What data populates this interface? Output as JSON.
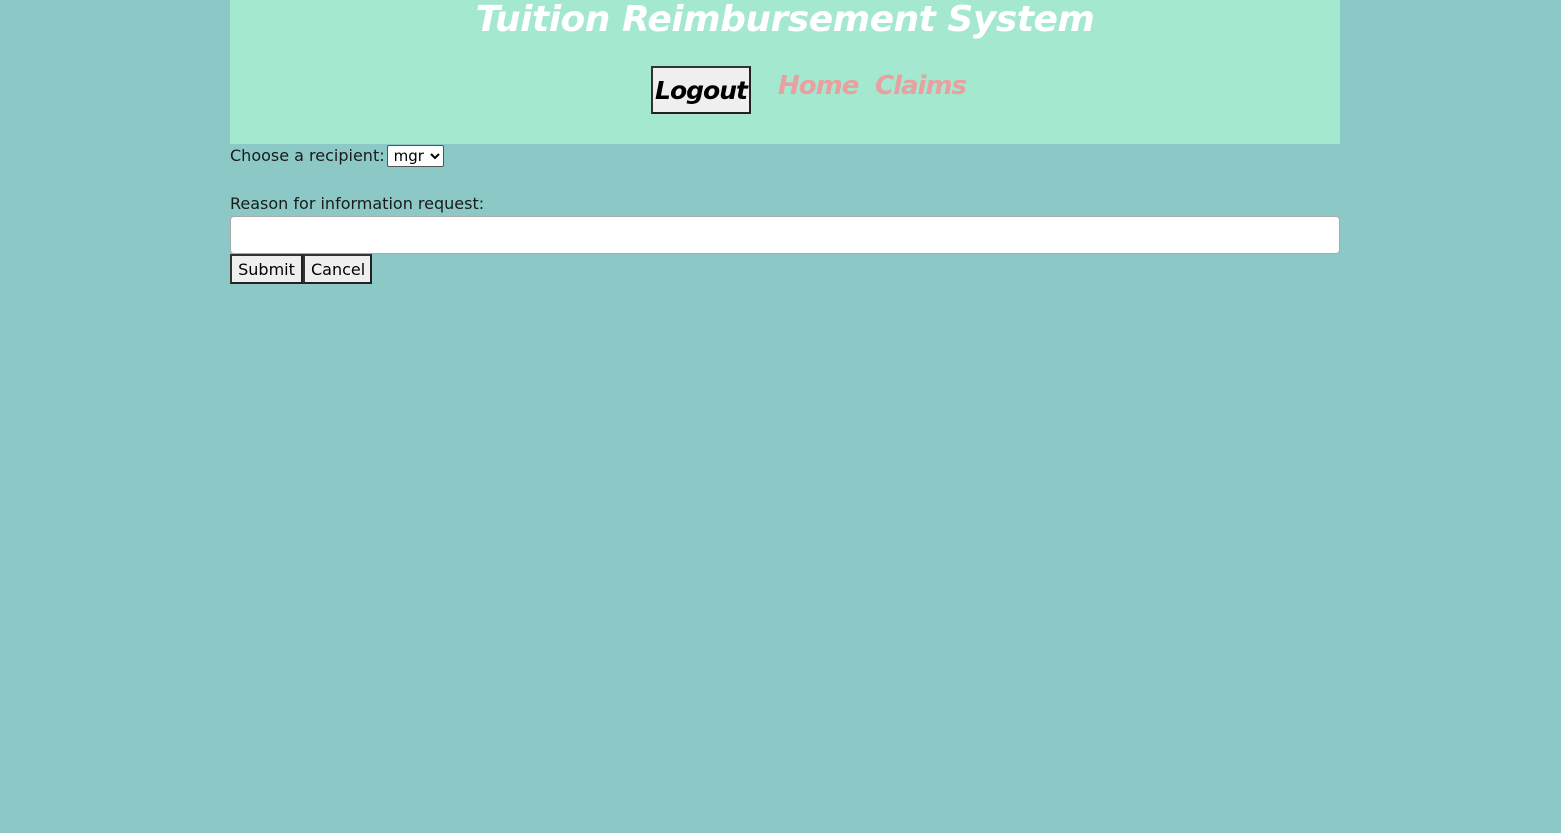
{
  "header": {
    "title": "Tuition Reimbursement System",
    "logout_label": "Logout",
    "nav": {
      "home": "Home",
      "claims": "Claims"
    },
    "link_color": "#e8a0a0",
    "background_color": "#a3e8cf"
  },
  "form": {
    "recipient_label": "Choose a recipient:",
    "recipient_selected": "mgr",
    "reason_label": "Reason for information request:",
    "reason_value": "",
    "submit_label": "Submit",
    "cancel_label": "Cancel"
  },
  "page": {
    "background_color": "#8cc8c6"
  }
}
